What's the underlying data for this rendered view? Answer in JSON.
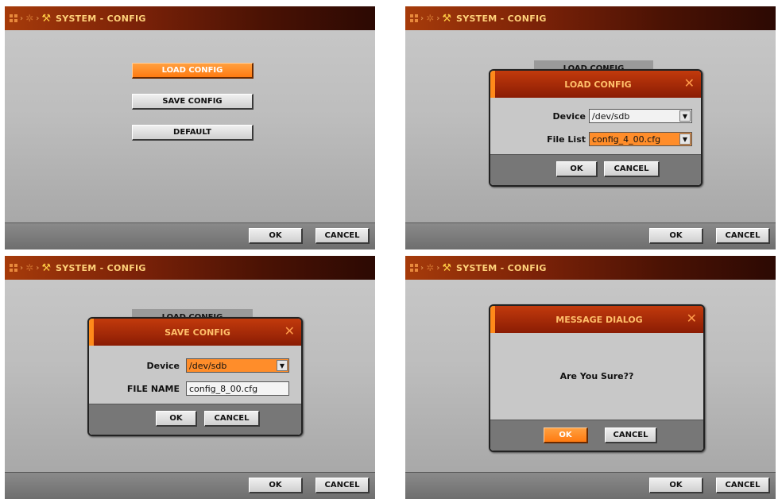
{
  "common": {
    "page_title": "SYSTEM - CONFIG",
    "ok_label": "OK",
    "cancel_label": "CANCEL"
  },
  "panel1": {
    "menu": [
      "LOAD CONFIG",
      "SAVE CONFIG",
      "DEFAULT"
    ],
    "selected": "LOAD CONFIG"
  },
  "panel2": {
    "dialog_title": "LOAD CONFIG",
    "device_label": "Device",
    "device_value": "/dev/sdb",
    "filelist_label": "File List",
    "filelist_value": "config_4_00.cfg",
    "ok_label": "OK",
    "cancel_label": "CANCEL"
  },
  "panel3": {
    "dialog_title": "SAVE CONFIG",
    "device_label": "Device",
    "device_value": "/dev/sdb",
    "filename_label": "FILE NAME",
    "filename_value": "config_8_00.cfg",
    "ok_label": "OK",
    "cancel_label": "CANCEL"
  },
  "panel4": {
    "dialog_title": "MESSAGE DIALOG",
    "message": "Are You Sure??",
    "ok_label": "OK",
    "cancel_label": "CANCEL"
  },
  "colors": {
    "accent": "#ff7a10",
    "titlebar": "#7c2208",
    "dialog_title": "#a0260a"
  }
}
